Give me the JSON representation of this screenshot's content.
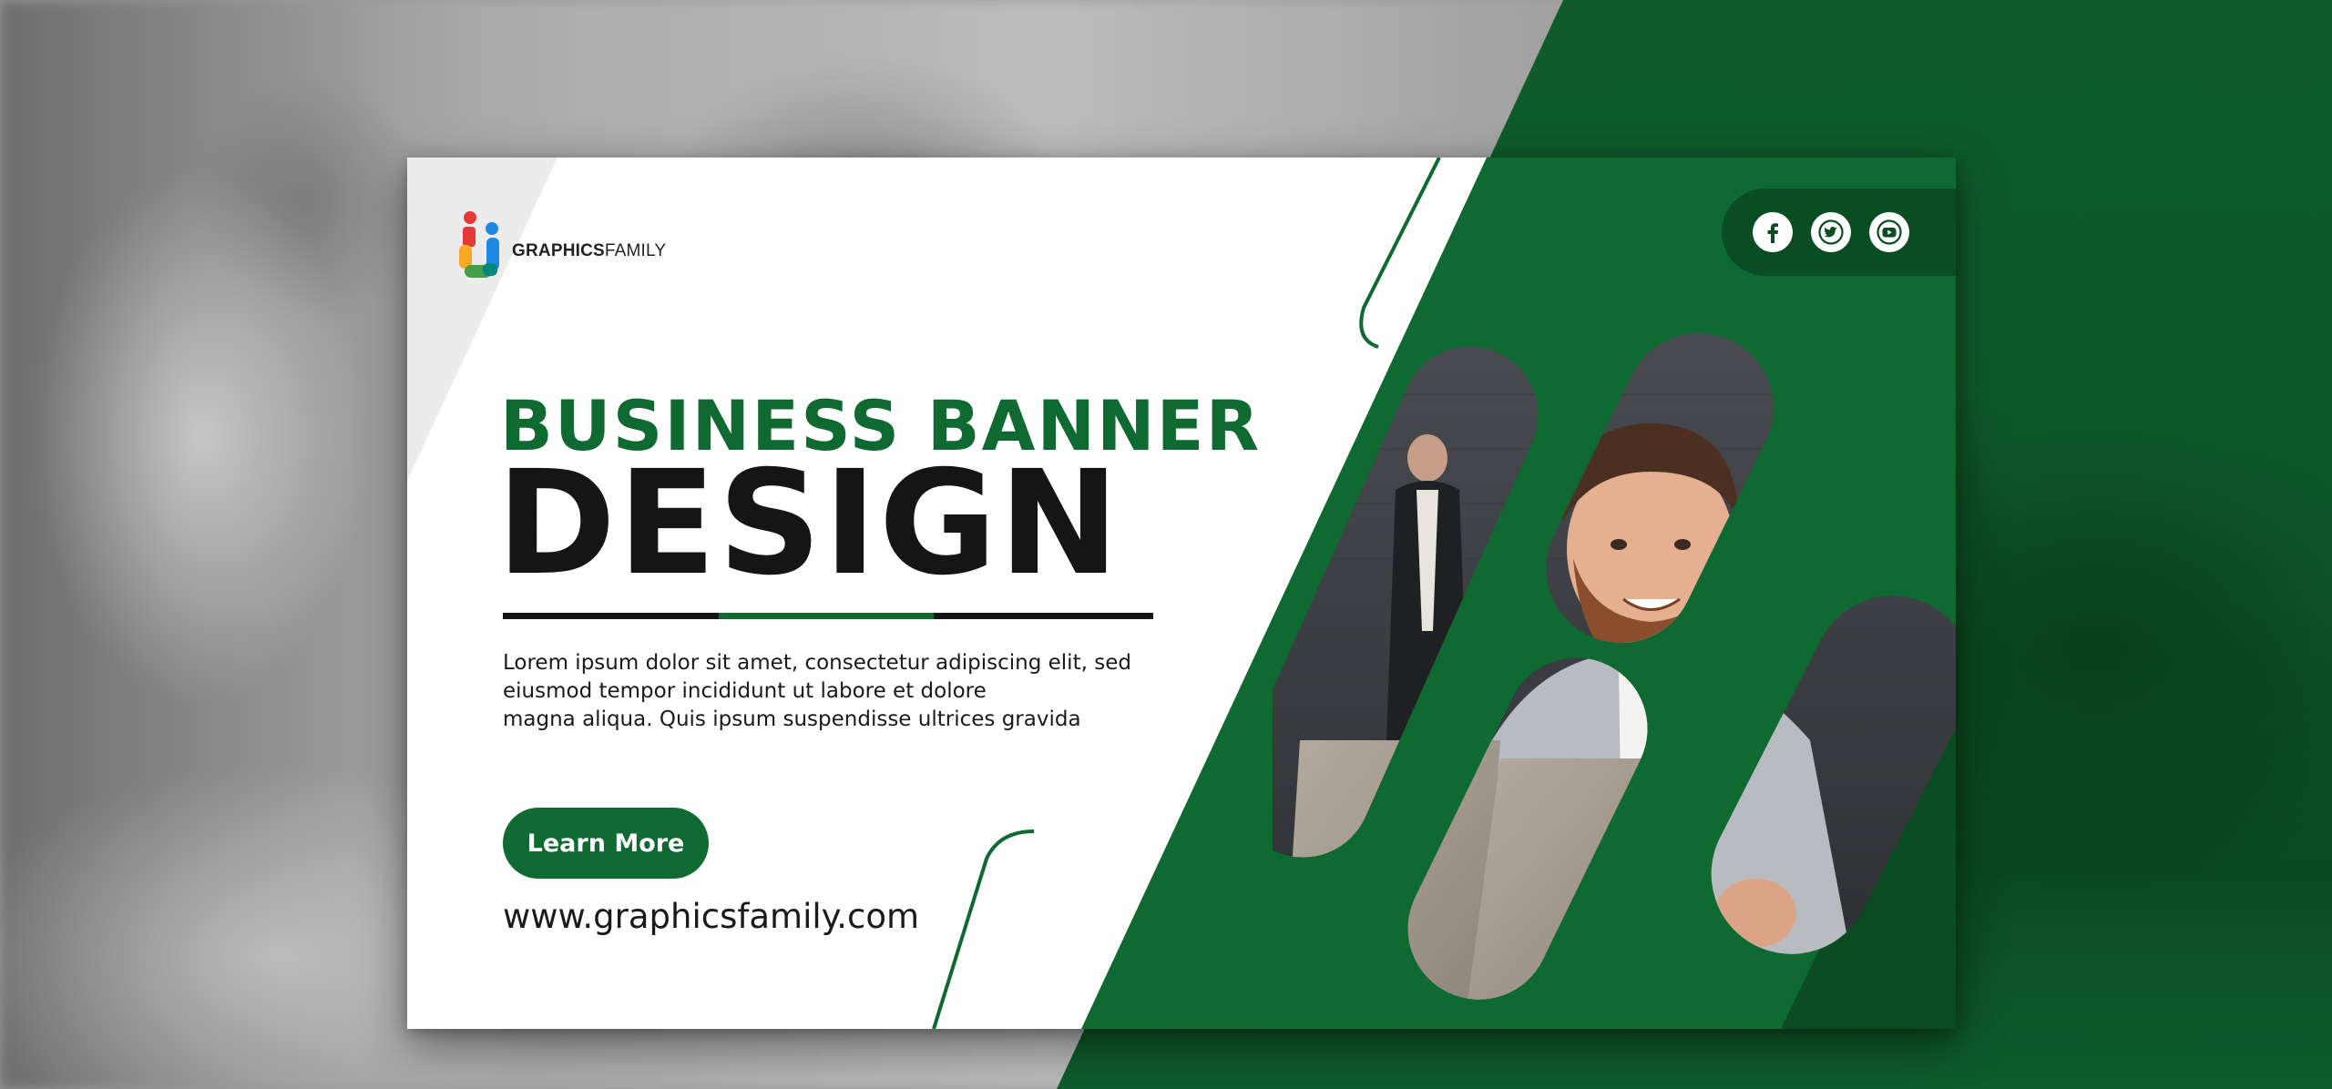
{
  "banner": {
    "logo": {
      "brand_bold": "GRAPHICS",
      "brand_light": "FAMILY"
    },
    "headline_top": "BUSINESS BANNER",
    "headline_main": "DESIGN",
    "body_lines": [
      "Lorem ipsum dolor sit amet, consectetur adipiscing elit, sed",
      "eiusmod tempor incididunt ut labore et dolore",
      "magna aliqua. Quis ipsum suspendisse ultrices gravida"
    ],
    "cta_label": "Learn More",
    "url": "www.graphicsfamily.com",
    "social_icons": [
      "facebook-icon",
      "twitter-icon",
      "youtube-icon"
    ]
  },
  "colors": {
    "brand_green": "#0e6a30",
    "dark_green": "#0a4d22",
    "text_dark": "#151515",
    "white": "#ffffff"
  }
}
